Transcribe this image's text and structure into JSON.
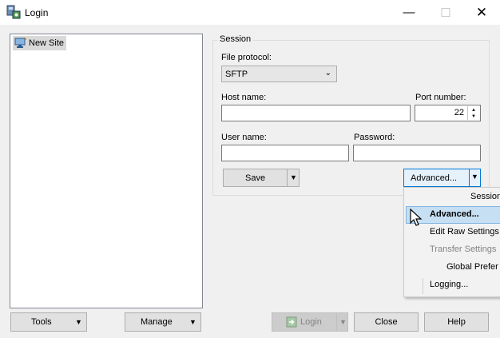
{
  "window": {
    "title": "Login"
  },
  "sites": {
    "items": [
      "New Site"
    ]
  },
  "session": {
    "legend": "Session",
    "file_protocol_label": "File protocol:",
    "file_protocol_value": "SFTP",
    "host_label": "Host name:",
    "host_value": "",
    "port_label": "Port number:",
    "port_value": "22",
    "user_label": "User name:",
    "user_value": "",
    "password_label": "Password:",
    "password_value": "",
    "save_label": "Save",
    "advanced_label": "Advanced..."
  },
  "advanced_menu": {
    "items": [
      {
        "label": "Session",
        "enabled": true,
        "highlighted": false
      },
      {
        "label": "Advanced...",
        "enabled": true,
        "highlighted": true
      },
      {
        "label": "Edit Raw Settings",
        "enabled": true,
        "highlighted": false
      },
      {
        "label": "Transfer Settings",
        "enabled": false,
        "highlighted": false
      },
      {
        "label": "Global Prefer",
        "enabled": true,
        "highlighted": false
      },
      {
        "label": "Logging...",
        "enabled": true,
        "highlighted": false
      }
    ]
  },
  "footer": {
    "tools_label": "Tools",
    "manage_label": "Manage",
    "login_label": "Login",
    "close_label": "Close",
    "help_label": "Help"
  },
  "colors": {
    "accent": "#0078d7",
    "menu_highlight": "#c7dff3",
    "disabled_text": "#838383"
  }
}
